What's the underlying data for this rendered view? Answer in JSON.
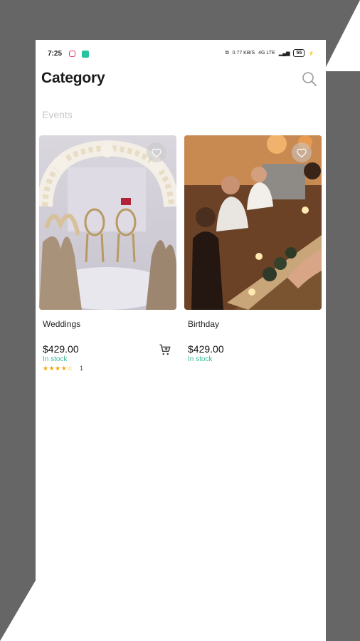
{
  "status_bar": {
    "time": "7:25",
    "net_speed": "0.77 KB/S",
    "network": "4G LTE",
    "battery": "55"
  },
  "header": {
    "title": "Category",
    "search_icon": "search-icon"
  },
  "section_label": "Events",
  "products": [
    {
      "name": "Weddings",
      "price": "$429.00",
      "stock": "In stock",
      "stars": "★★★★☆",
      "rating_count": "1",
      "icons": [
        "heart-icon",
        "add-to-cart-icon"
      ]
    },
    {
      "name": "Birthday",
      "price": "$429.00",
      "stock": "In stock",
      "icons": [
        "heart-icon"
      ]
    }
  ],
  "colors": {
    "accent_green": "#3bb89a",
    "star": "#f0a400",
    "background_frame": "#666666"
  }
}
